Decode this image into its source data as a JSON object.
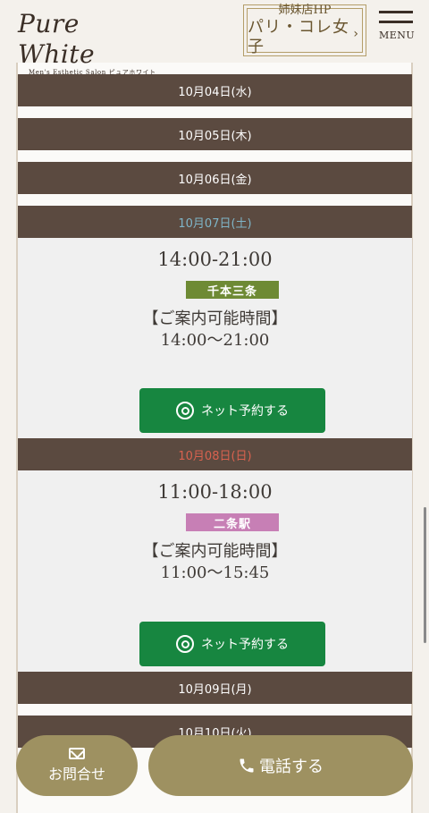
{
  "header": {
    "logo_text": "Pure White",
    "logo_sub": "Men's Esthetic Salon ピュアホワイト",
    "sister_label": "姉妹店HP",
    "sister_name": "パリ・コレ女子",
    "menu_label": "MENU"
  },
  "schedule": {
    "dates": [
      "10月04日(水)",
      "10月05日(木)",
      "10月06日(金)",
      "10月07日(土)",
      "10月08日(日)",
      "10月09日(月)",
      "10月10日(火)"
    ],
    "cards": [
      {
        "time_range": "14:00-21:00",
        "location": "千本三条",
        "guide_title": "【ご案内可能時間】",
        "guide_time": "14:00〜21:00",
        "reserve_label": "ネット予約する"
      },
      {
        "time_range": "11:00-18:00",
        "location": "二条駅",
        "guide_title": "【ご案内可能時間】",
        "guide_time": "11:00〜15:45",
        "reserve_label": "ネット予約する"
      }
    ]
  },
  "footer": {
    "contact_label": "お問合せ",
    "tel_label": "電話する"
  },
  "colors": {
    "date_bar": "#5b4a40",
    "reserve_green": "#178640",
    "footer_gold": "#9e9161",
    "saturday": "#7fb5c8",
    "sunday": "#d9624f"
  }
}
